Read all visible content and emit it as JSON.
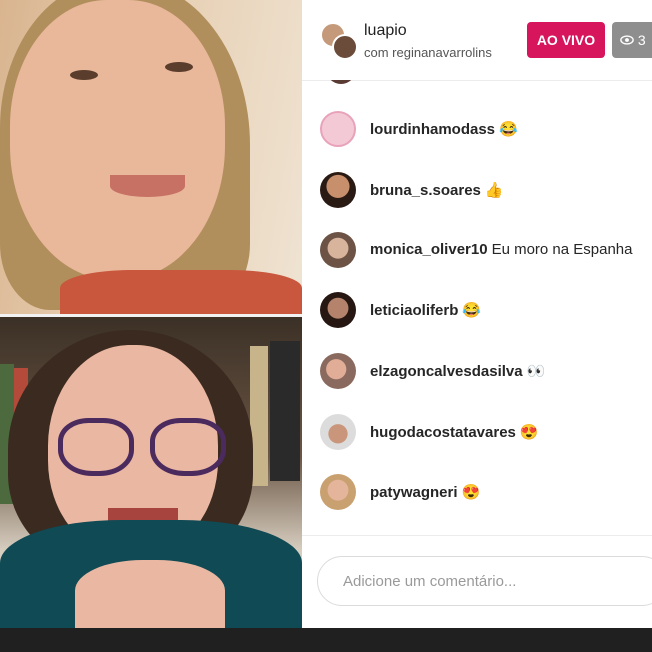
{
  "header": {
    "host_username": "luapio",
    "guest_line": "com reginanavarrolins",
    "live_label": "AO VIVO",
    "viewer_count": "3",
    "viewer_icon": "eye-icon"
  },
  "comments": [
    {
      "username": "lourdinhamodass",
      "message": "😂"
    },
    {
      "username": "bruna_s.soares",
      "message": "👍"
    },
    {
      "username": "monica_oliver10",
      "message": "Eu moro na Espanha"
    },
    {
      "username": "leticiaoliferb",
      "message": "😂"
    },
    {
      "username": "elzagoncalvesdasilva",
      "message": "👀"
    },
    {
      "username": "hugodacostatavares",
      "message": "😍"
    },
    {
      "username": "patywagneri",
      "message": "😍"
    }
  ],
  "footer": {
    "comment_placeholder": "Adicione um comentário..."
  },
  "colors": {
    "live_badge": "#d6155d",
    "viewer_badge": "#8e8e8e"
  }
}
